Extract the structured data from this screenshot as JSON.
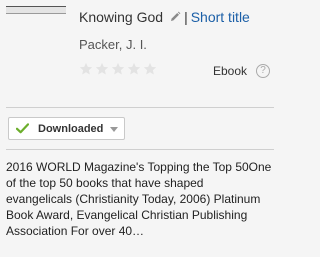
{
  "book": {
    "title": "Knowing God",
    "separator": "|",
    "short_title_link": "Short title",
    "author": "Packer, J. I.",
    "rating_stars": 0,
    "format": "Ebook",
    "help_symbol": "?"
  },
  "status": {
    "label": "Downloaded"
  },
  "description": "2016 WORLD Magazine's Topping the Top 50One of the top 50 books that have shaped evangelicals (Christianity Today, 2006) Platinum Book Award, Evangelical Christian Publishing Association For over 40…",
  "colors": {
    "link": "#1b5fa7",
    "check": "#6cae2c",
    "star_empty": "#e3e3e3"
  }
}
